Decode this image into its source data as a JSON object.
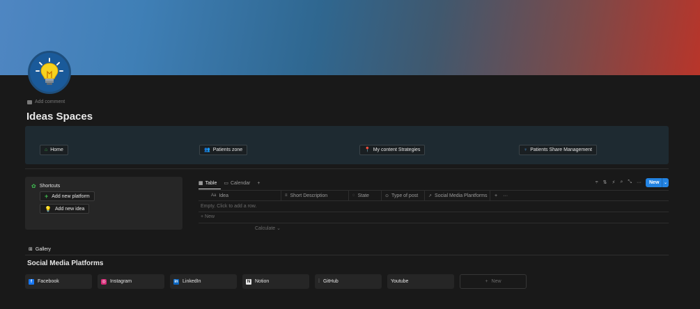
{
  "page": {
    "title": "Ideas Spaces",
    "add_comment": "Add comment"
  },
  "nav": [
    {
      "label": "Home",
      "icon": "home-icon",
      "color": "#3fb950"
    },
    {
      "label": "Patients zone",
      "icon": "people-icon",
      "color": "#3fb950"
    },
    {
      "label": "My content Strategies",
      "icon": "pin-icon",
      "color": "#e05252"
    },
    {
      "label": "Patients Share Management",
      "icon": "person-icon",
      "color": "#4a9ae0"
    }
  ],
  "shortcuts": {
    "title": "Shortcuts",
    "items": [
      {
        "label": "Add new platform",
        "icon": "plus-icon"
      },
      {
        "label": "Add new idea",
        "icon": "lightbulb-icon"
      }
    ]
  },
  "database": {
    "tabs": [
      {
        "label": "Table",
        "icon": "table-icon"
      },
      {
        "label": "Calendar",
        "icon": "calendar-icon"
      }
    ],
    "new_button": "New",
    "columns": [
      {
        "label": "Idea",
        "icon": "Aa"
      },
      {
        "label": "Short Description",
        "icon": "≡"
      },
      {
        "label": "State",
        "icon": "◌"
      },
      {
        "label": "Type of post",
        "icon": "⊙"
      },
      {
        "label": "Social Media Plantforms",
        "icon": "↗"
      }
    ],
    "empty_text": "Empty. Click to add a row.",
    "new_row": "New",
    "calculate": "Calculate"
  },
  "gallery": {
    "tab": "Gallery",
    "title": "Social Media Platforms",
    "cards": [
      {
        "label": "Facebook",
        "icon": "facebook-icon",
        "color": "#1877f2"
      },
      {
        "label": "Instagram",
        "icon": "instagram-icon",
        "color": "#d62976"
      },
      {
        "label": "LinkedIn",
        "icon": "linkedin-icon",
        "color": "#0a66c2"
      },
      {
        "label": "Notion",
        "icon": "notion-icon",
        "color": "#e6e6e6"
      },
      {
        "label": "GitHub",
        "icon": "github-icon",
        "color": "#9b9b9b"
      },
      {
        "label": "Youtube",
        "icon": "youtube-icon",
        "color": ""
      }
    ],
    "new_card": "New"
  }
}
